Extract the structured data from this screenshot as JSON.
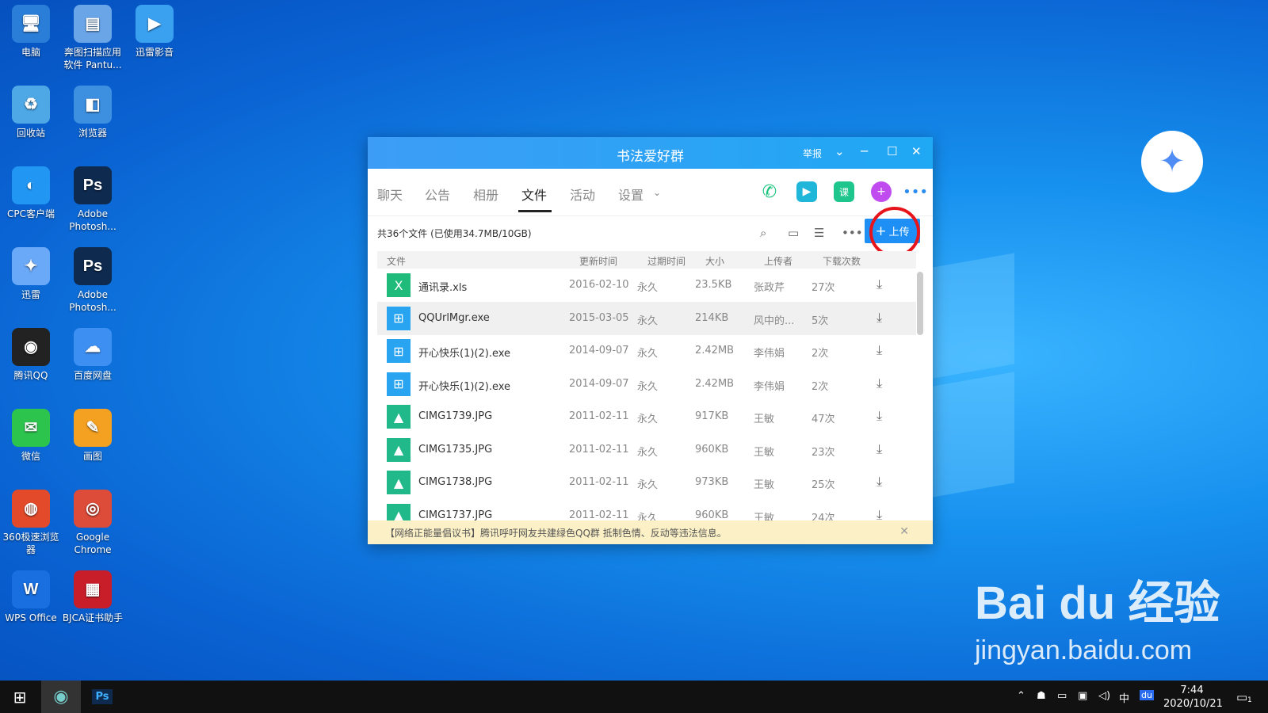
{
  "desktop": {
    "icons": [
      {
        "label": "电脑",
        "glyph": "🖥",
        "color": "#2a7ed8"
      },
      {
        "label": "奔图扫描应用软件 Pantu...",
        "glyph": "▤",
        "color": "#6aa5e8"
      },
      {
        "label": "迅雷影音",
        "glyph": "▶",
        "color": "#3aa0f0"
      },
      {
        "label": "回收站",
        "glyph": "♻",
        "color": "#4ea8e6"
      },
      {
        "label": "浏览器",
        "glyph": "◧",
        "color": "#3d8fe0"
      },
      {
        "label": "CPC客户端",
        "glyph": "◐",
        "color": "#2196f3"
      },
      {
        "label": "Adobe Photosh...",
        "glyph": "Ps",
        "color": "#0e2a4f"
      },
      {
        "label": "迅雷",
        "glyph": "✦",
        "color": "#6aa8f8"
      },
      {
        "label": "Adobe Photosh...",
        "glyph": "Ps",
        "color": "#0e2a4f"
      },
      {
        "label": "腾讯QQ",
        "glyph": "◉",
        "color": "#222"
      },
      {
        "label": "百度网盘",
        "glyph": "☁",
        "color": "#3d8ff2"
      },
      {
        "label": "微信",
        "glyph": "✉",
        "color": "#2dc44e"
      },
      {
        "label": "画图",
        "glyph": "✎",
        "color": "#f4a020"
      },
      {
        "label": "360极速浏览器",
        "glyph": "◍",
        "color": "#e34a2a"
      },
      {
        "label": "Google Chrome",
        "glyph": "◎",
        "color": "#dd4b39"
      },
      {
        "label": "WPS Office",
        "glyph": "W",
        "color": "#1a6fe0"
      },
      {
        "label": "BJCA证书助手",
        "glyph": "▦",
        "color": "#c81e2a"
      }
    ]
  },
  "window": {
    "title": "书法爱好群",
    "report": "举报",
    "tabs": [
      "聊天",
      "公告",
      "相册",
      "文件",
      "活动",
      "设置"
    ],
    "summary": "共36个文件 (已使用34.7MB/10GB)",
    "upload": "上传",
    "columns": [
      "文件",
      "更新时间",
      "过期时间",
      "大小",
      "上传者",
      "下载次数"
    ],
    "files": [
      {
        "icon": "X",
        "color": "#1fbb7a",
        "name": "通讯录.xls",
        "date": "2016-02-10",
        "expire": "永久",
        "size": "23.5KB",
        "uploader": "张政芹",
        "count": "27次"
      },
      {
        "icon": "⊞",
        "color": "#29a4f0",
        "name": "QQUrlMgr.exe",
        "date": "2015-03-05",
        "expire": "永久",
        "size": "214KB",
        "uploader": "风中的...",
        "count": "5次"
      },
      {
        "icon": "⊞",
        "color": "#29a4f0",
        "name": "开心快乐(1)(2).exe",
        "date": "2014-09-07",
        "expire": "永久",
        "size": "2.42MB",
        "uploader": "李伟娟",
        "count": "2次"
      },
      {
        "icon": "⊞",
        "color": "#29a4f0",
        "name": "开心快乐(1)(2).exe",
        "date": "2014-09-07",
        "expire": "永久",
        "size": "2.42MB",
        "uploader": "李伟娟",
        "count": "2次"
      },
      {
        "icon": "▲",
        "color": "#21b98a",
        "name": "CIMG1739.JPG",
        "date": "2011-02-11",
        "expire": "永久",
        "size": "917KB",
        "uploader": "王敏",
        "count": "47次"
      },
      {
        "icon": "▲",
        "color": "#21b98a",
        "name": "CIMG1735.JPG",
        "date": "2011-02-11",
        "expire": "永久",
        "size": "960KB",
        "uploader": "王敏",
        "count": "23次"
      },
      {
        "icon": "▲",
        "color": "#21b98a",
        "name": "CIMG1738.JPG",
        "date": "2011-02-11",
        "expire": "永久",
        "size": "973KB",
        "uploader": "王敏",
        "count": "25次"
      },
      {
        "icon": "▲",
        "color": "#21b98a",
        "name": "CIMG1737.JPG",
        "date": "2011-02-11",
        "expire": "永久",
        "size": "960KB",
        "uploader": "王敏",
        "count": "24次"
      }
    ],
    "notice": "【网络正能量倡议书】腾讯呼吁网友共建绿色QQ群 抵制色情、反动等违法信息。"
  },
  "taskbar": {
    "time": "7:44",
    "date": "2020/10/21",
    "ime": "中",
    "notif": "1"
  },
  "watermark": {
    "brand": "Bai du 经验",
    "url": "jingyan.baidu.com"
  }
}
